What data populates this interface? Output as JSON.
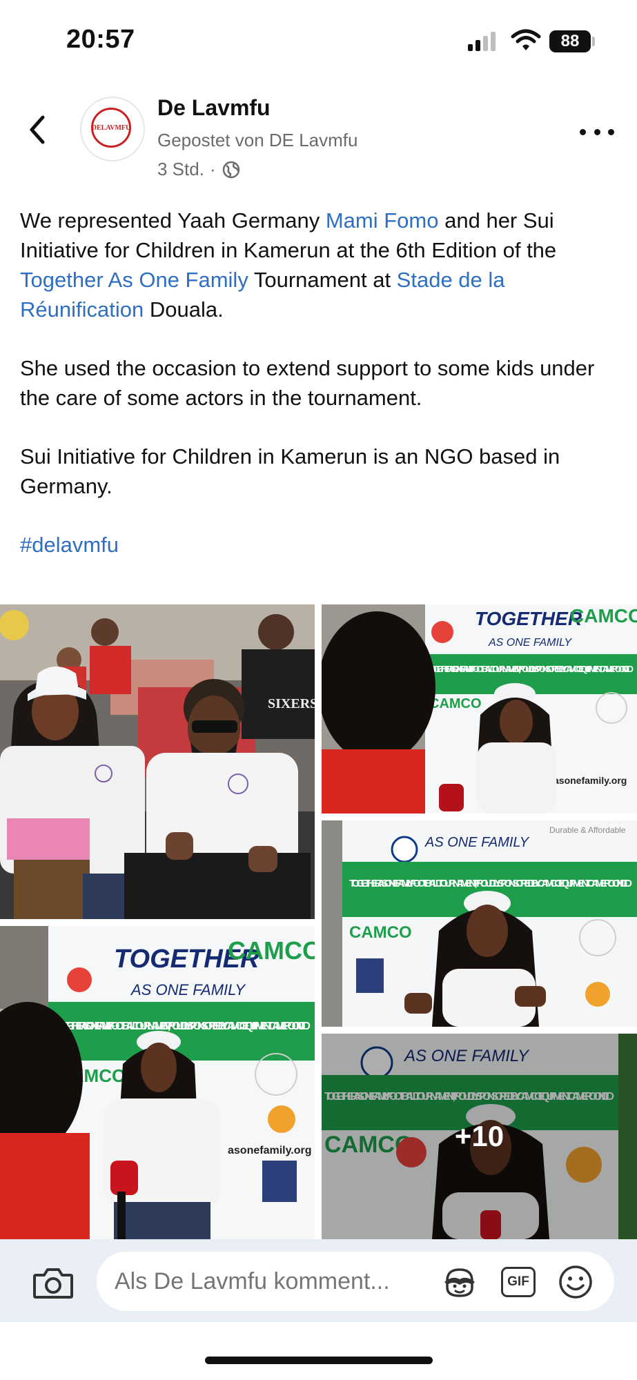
{
  "status_bar": {
    "time": "20:57",
    "battery": "88"
  },
  "header": {
    "page_name": "De Lavmfu",
    "posted_by": "Gepostet von DE Lavmfu",
    "time_ago": "3 Std.",
    "separator": "·",
    "avatar_text": "DELAVMFU"
  },
  "post": {
    "p1_a": "We represented Yaah Germany ",
    "p1_link1": "Mami Fomo",
    "p1_b": " and her Sui Initiative for Children in Kamerun at the 6th Edition of the ",
    "p1_link2": "Together As One Family",
    "p1_c": " Tournament at ",
    "p1_link3": "Stade de la Réunification",
    "p1_d": " Douala.",
    "p2": "She used the occasion to extend support to some kids under the care of some actors in the tournament.",
    "p3": "Sui Initiative for Children in Kamerun is an NGO based in Germany.",
    "hashtag": "#delavmfu"
  },
  "photos": {
    "more_count": "+10",
    "banner_title_1": "TOGETHER",
    "banner_title_2": "AS ONE FAMILY",
    "banner_strip": "TOGETHER AS ONE FAMILY FOOTBALL TOURNAMENT, PROUDLY SPONSORED BY CAMCO EQUIPMENT CAMEROON LTD",
    "sponsor": "CAMCO",
    "sponsor_tag": "Durable & Affordable",
    "website": "asonefamily.org",
    "jersey": "SIXERS"
  },
  "comment_bar": {
    "placeholder": "Als De Lavmfu komment...",
    "gif_label": "GIF"
  },
  "colors": {
    "link": "#2f6fc1",
    "banner_green": "#1e9e4a",
    "accent_red": "#cc1f1f"
  }
}
